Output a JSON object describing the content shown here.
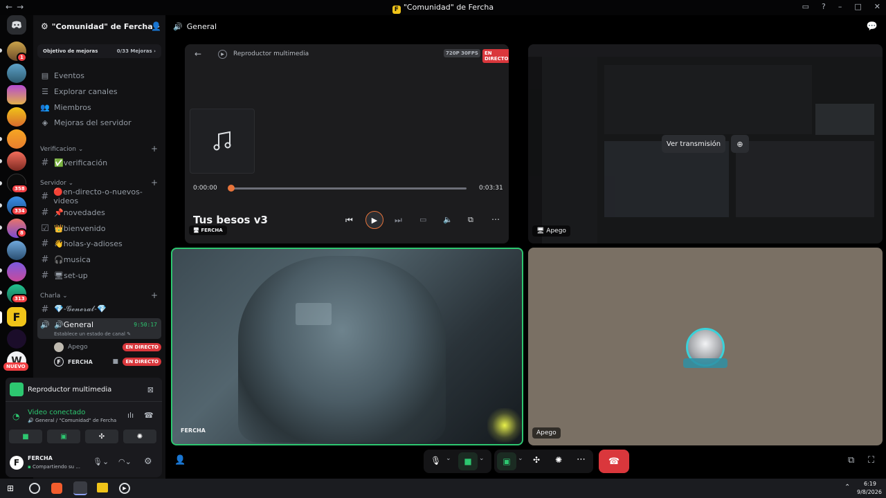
{
  "window": {
    "title": "\"Comunidad\" de Fercha",
    "server_icon_letter": "F",
    "nav_back": "←",
    "nav_forward": "→"
  },
  "rail": {
    "badges": [
      "1",
      "358",
      "334",
      "8",
      "313"
    ],
    "new_label": "NUEVO"
  },
  "server": {
    "name": "\"Comunidad\" de Fercha",
    "boost": {
      "label": "Objetivo de mejoras",
      "progress": "0/33 Mejoras"
    },
    "menu": [
      "Eventos",
      "Explorar canales",
      "Miembros",
      "Mejoras del servidor"
    ],
    "categories": [
      {
        "name": "Verificacion",
        "channels": [
          "✅verificación"
        ]
      },
      {
        "name": "Servidor",
        "channels": [
          "🔴en-directo-o-nuevos-videos",
          "📌novedades",
          "👑bienvenido",
          "👋holas-y-adioses",
          "🎧musica",
          "🖥set-up"
        ]
      },
      {
        "name": "Charla",
        "channels": [
          "💎-𝓖𝓮𝓷𝓮𝓻𝓪𝓵-💎"
        ]
      }
    ],
    "voice_channel": {
      "name": "🔊General",
      "timer": "9:50:17",
      "status_hint": "Establece un estado de canal",
      "members": [
        {
          "name": "Apego",
          "badge": "EN DIRECTO"
        },
        {
          "name": "FERCHA",
          "badge": "EN DIRECTO"
        }
      ]
    }
  },
  "media_panel": {
    "title": "Reproductor multimedia"
  },
  "voice_panel": {
    "status": "Video conectado",
    "location": "General / \"Comunidad\" de Fercha",
    "user": {
      "name": "FERCHA",
      "status": "Compartiendo su ..."
    }
  },
  "main": {
    "channel": "General",
    "player": {
      "title": "Reproductor multimedia",
      "quality": "720P 30FPS",
      "live": "EN DIRECTO",
      "time_current": "0:00:00",
      "time_total": "0:03:31",
      "song": "Tus besos v3",
      "progress": 0.0
    },
    "tiles": [
      {
        "label": "FERCHA"
      },
      {
        "label": "Apego",
        "action": "Ver transmisión"
      },
      {
        "label": "FERCHA"
      },
      {
        "label": "Apego"
      }
    ]
  },
  "taskbar": {
    "time": "6:19",
    "date": "9/8/2026"
  },
  "colors": {
    "accent_green": "#2dc770",
    "live_red": "#da373c",
    "hangup": "#da373c"
  }
}
